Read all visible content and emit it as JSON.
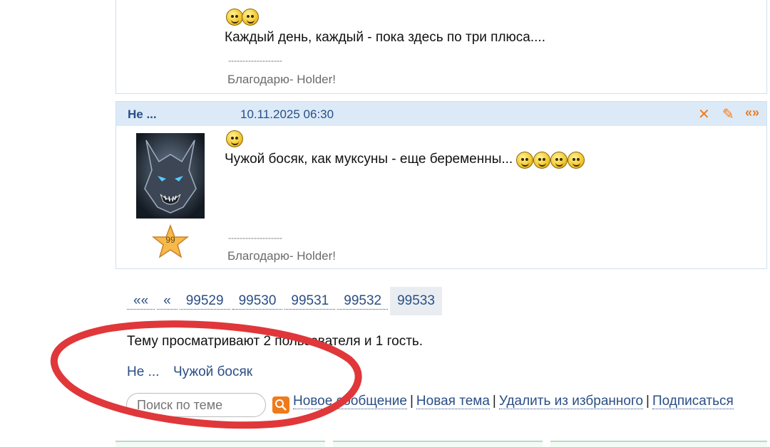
{
  "posts": [
    {
      "message": "Каждый день, каждый - пока здесь по три плюса....",
      "signature_divider": "-------------------",
      "signature": "Благодарю- Holder!"
    },
    {
      "author": "Не ...",
      "date": "10.11.2025 06:30",
      "message": "Чужой босяк, как муксуны - еще беременны...",
      "signature_divider": "-------------------",
      "signature": "Благодарю- Holder!",
      "badge_rank": "99",
      "actions": {
        "delete": "✕",
        "edit": "✎",
        "quote": "«»"
      }
    }
  ],
  "pagination": {
    "first": "««",
    "prev": "«",
    "pages": [
      "99529",
      "99530",
      "99531",
      "99532",
      "99533"
    ],
    "current": "99533"
  },
  "viewers": {
    "text": "Тему просматривают 2 пользователя и 1 гость.",
    "users": [
      "Не ...",
      "Чужой босяк"
    ]
  },
  "search": {
    "placeholder": "Поиск по теме"
  },
  "topic_links": {
    "new_message": "Новое сообщение",
    "new_topic": "Новая тема",
    "remove_favorite": "Удалить из избранного",
    "subscribe": "Подписаться",
    "separator": "|"
  },
  "colors": {
    "link": "#2a4e86",
    "accent": "#f07a1a",
    "header_bg": "#dceaf8",
    "annotation": "#e0373a"
  }
}
